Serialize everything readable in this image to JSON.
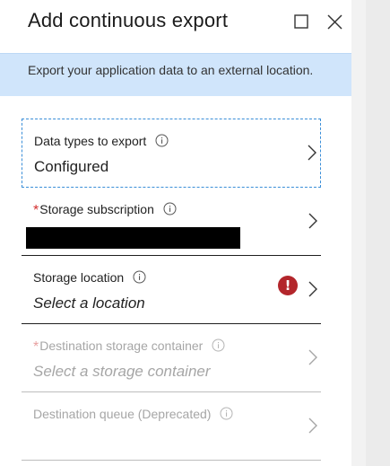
{
  "blade": {
    "title": "Add continuous export",
    "maximize_icon": "maximize-icon",
    "close_icon": "close-icon",
    "info_banner": "Export your application data to an external location."
  },
  "fields": [
    {
      "label": "Data types to export",
      "required": false,
      "value": "Configured",
      "disabled": false,
      "icon": "info-icon"
    },
    {
      "label": "Storage subscription",
      "required": true,
      "required_marker": "*",
      "value": "",
      "redacted": true,
      "disabled": false,
      "icon": "info-icon"
    },
    {
      "label": "Storage location",
      "required": false,
      "value": "Select a location",
      "disabled": false,
      "error_marker": "!",
      "icon": "info-icon"
    },
    {
      "label": "Destination storage container",
      "required": true,
      "required_marker": "*",
      "value": "Select a storage container",
      "disabled": true,
      "icon": "info-icon"
    },
    {
      "label": "Destination queue (Deprecated)",
      "required": false,
      "value": "",
      "disabled": true,
      "icon": "info-icon"
    }
  ],
  "colors": {
    "banner_bg": "#d0e5fb",
    "focus_border": "#3a8ed8",
    "required_star": "#d32f2f",
    "error_badge": "#b3262b",
    "disabled_text": "#a6a6a6"
  }
}
